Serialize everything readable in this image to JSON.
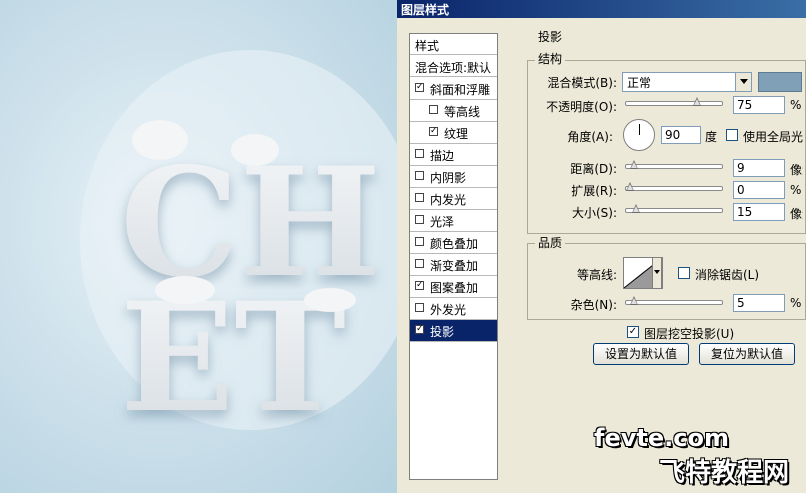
{
  "dialog": {
    "title": "图层样式"
  },
  "left_panel": {
    "header": "样式",
    "blend_options": "混合选项:默认",
    "items": [
      {
        "label": "斜面和浮雕",
        "checked": true,
        "indent": false
      },
      {
        "label": "等高线",
        "checked": false,
        "indent": true
      },
      {
        "label": "纹理",
        "checked": true,
        "indent": true
      },
      {
        "label": "描边",
        "checked": false,
        "indent": false
      },
      {
        "label": "内阴影",
        "checked": false,
        "indent": false
      },
      {
        "label": "内发光",
        "checked": false,
        "indent": false
      },
      {
        "label": "光泽",
        "checked": false,
        "indent": false
      },
      {
        "label": "颜色叠加",
        "checked": false,
        "indent": false
      },
      {
        "label": "渐变叠加",
        "checked": false,
        "indent": false
      },
      {
        "label": "图案叠加",
        "checked": true,
        "indent": false
      },
      {
        "label": "外发光",
        "checked": false,
        "indent": false
      },
      {
        "label": "投影",
        "checked": true,
        "indent": false,
        "selected": true
      }
    ]
  },
  "drop_shadow": {
    "title": "投影",
    "structure": {
      "title": "结构",
      "blend_mode_label": "混合模式(B):",
      "blend_mode_value": "正常",
      "shadow_color": "#7fa0b6",
      "opacity_label": "不透明度(O):",
      "opacity_value": "75",
      "opacity_unit": "%",
      "opacity_fraction": 0.75,
      "angle_label": "角度(A):",
      "angle_value": "90",
      "angle_unit": "度",
      "global_light_label": "使用全局光",
      "distance_label": "距离(D):",
      "distance_value": "9",
      "distance_unit": "像素",
      "distance_fraction": 0.05,
      "spread_label": "扩展(R):",
      "spread_value": "0",
      "spread_unit": "%",
      "spread_fraction": 0.0,
      "size_label": "大小(S):",
      "size_value": "15",
      "size_unit": "像素",
      "size_fraction": 0.07
    },
    "quality": {
      "title": "品质",
      "contour_label": "等高线:",
      "antialias_label": "消除锯齿(L)",
      "noise_label": "杂色(N):",
      "noise_value": "5",
      "noise_unit": "%",
      "noise_fraction": 0.05
    },
    "knockout_label": "图层挖空投影(U)",
    "knockout_checked": true,
    "set_default_button": "设置为默认值",
    "reset_default_button": "复位为默认值"
  },
  "canvas": {
    "line1": "CH",
    "line2": "ET"
  },
  "watermark": {
    "line1": "fevte.com",
    "line2": "飞特教程网"
  }
}
